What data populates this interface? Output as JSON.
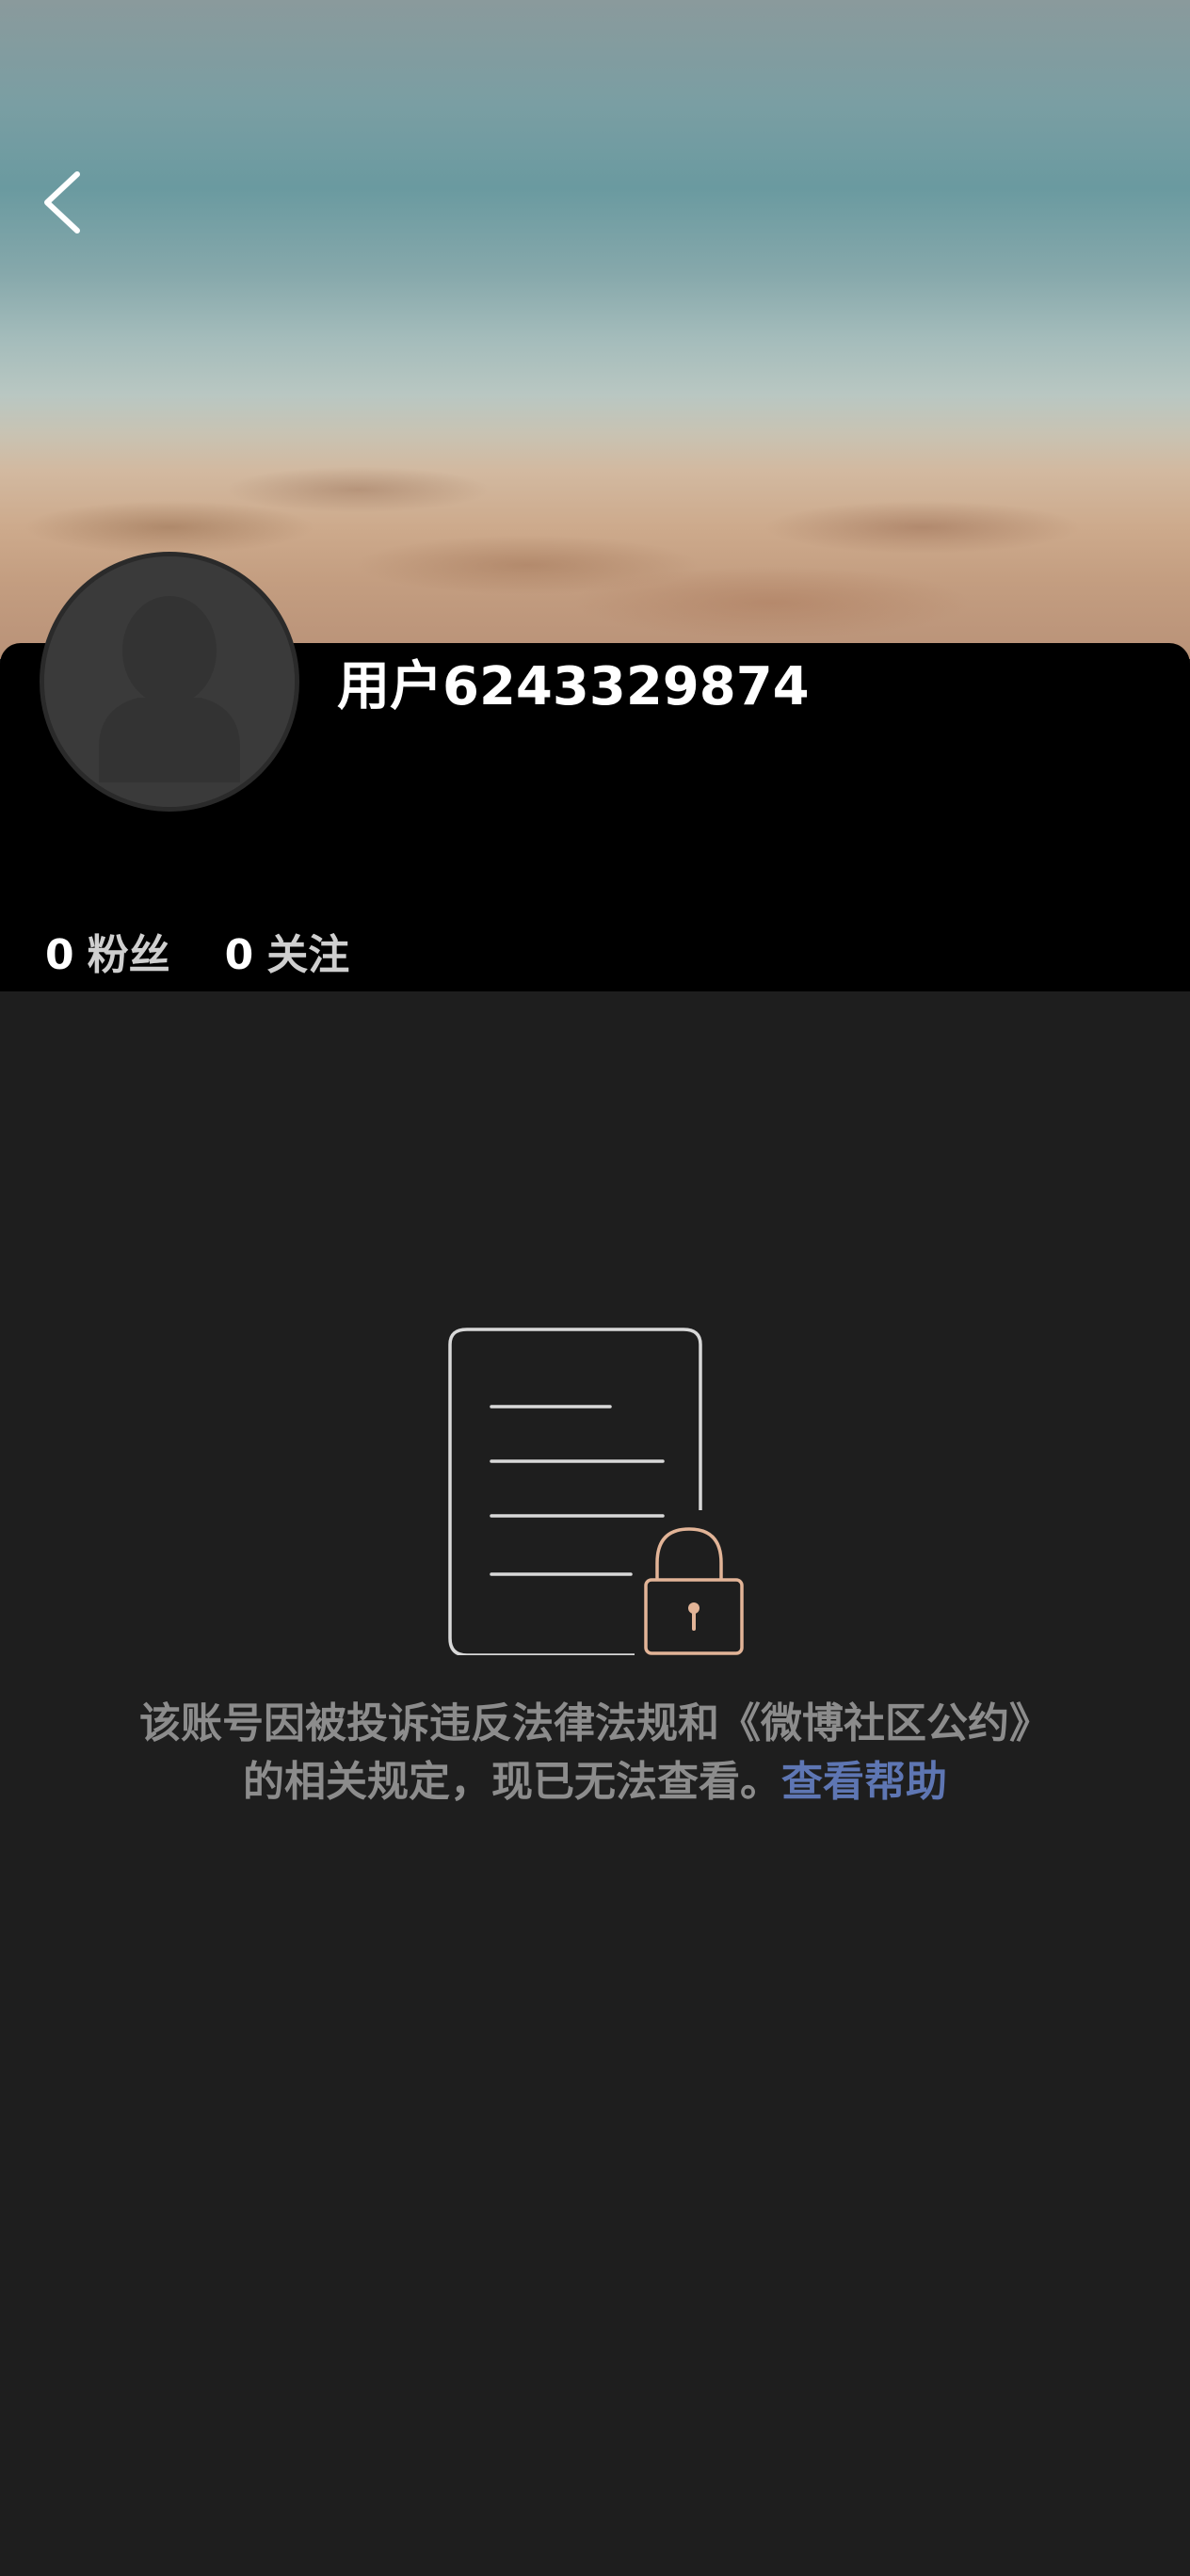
{
  "profile": {
    "username": "用户6243329874",
    "fans_count": "0",
    "fans_label": "粉丝",
    "following_count": "0",
    "following_label": "关注"
  },
  "notice": {
    "message": "该账号因被投诉违反法律法规和《微博社区公约》的相关规定，现已无法查看。",
    "help_link": "查看帮助"
  },
  "icons": {
    "back": "chevron-left-icon",
    "avatar": "default-avatar-silhouette",
    "illustration": "locked-document-icon"
  },
  "colors": {
    "panel": "#000000",
    "background": "#1e1e1e",
    "notice_text": "#8c8c8c",
    "link": "#5e76b3",
    "lock": "#e2b497"
  }
}
